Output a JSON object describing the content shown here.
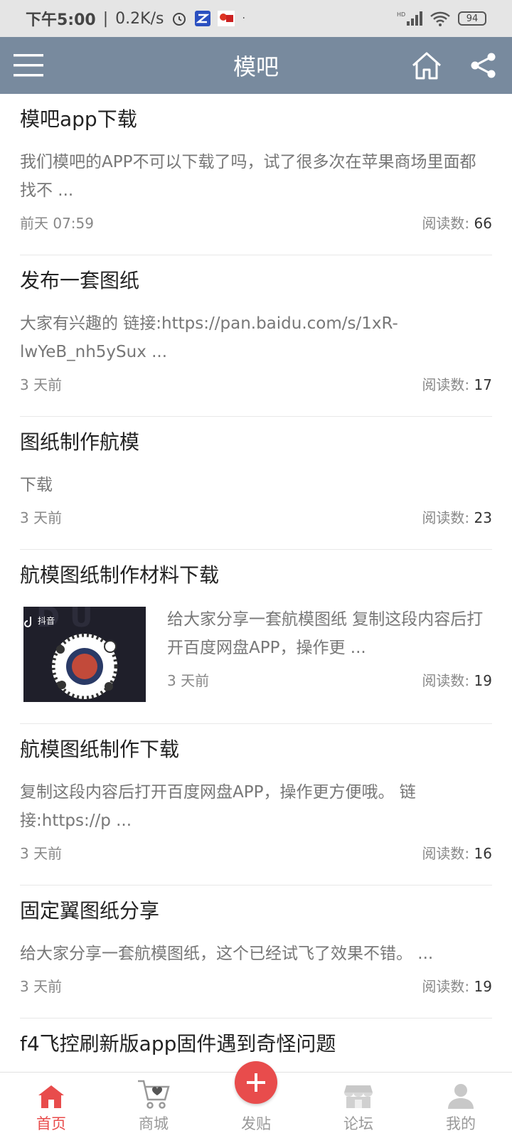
{
  "status_bar": {
    "time": "下午5:00",
    "speed": "0.2K/s",
    "network": "HD",
    "battery": "94"
  },
  "header": {
    "title": "模吧",
    "bg_color": "#788a9e"
  },
  "posts": [
    {
      "title": "模吧app下载",
      "excerpt": "我们模吧的APP不可以下载了吗，试了很多次在苹果商场里面都找不 ...",
      "time": "前天 07:59",
      "reads_label": "阅读数:",
      "reads": "66"
    },
    {
      "title": "发布一套图纸",
      "excerpt": "大家有兴趣的 链接:https://pan.baidu.com/s/1xR-lwYeB_nh5ySux ...",
      "time": "3 天前",
      "reads_label": "阅读数:",
      "reads": "17"
    },
    {
      "title": "图纸制作航模",
      "excerpt": "下载",
      "time": "3 天前",
      "reads_label": "阅读数:",
      "reads": "23"
    },
    {
      "title": "航模图纸制作材料下载",
      "excerpt": "给大家分享一套航模图纸 复制这段内容后打开百度网盘APP，操作更 ...",
      "time": "3 天前",
      "reads_label": "阅读数:",
      "reads": "19",
      "thumb_label": "抖音"
    },
    {
      "title": "航模图纸制作下载",
      "excerpt": "复制这段内容后打开百度网盘APP，操作更方便哦。 链接:https://p ...",
      "time": "3 天前",
      "reads_label": "阅读数:",
      "reads": "16"
    },
    {
      "title": "固定翼图纸分享",
      "excerpt": "给大家分享一套航模图纸，这个已经试飞了效果不错。 ...",
      "time": "3 天前",
      "reads_label": "阅读数:",
      "reads": "19"
    },
    {
      "title": "f4飞控刷新版app固件遇到奇怪问题"
    }
  ],
  "bottom_nav": {
    "items": [
      {
        "label": "首页",
        "icon": "home-icon",
        "active": true
      },
      {
        "label": "商城",
        "icon": "cart-icon"
      },
      {
        "label": "发贴",
        "icon": "plus-icon"
      },
      {
        "label": "论坛",
        "icon": "forum-icon"
      },
      {
        "label": "我的",
        "icon": "user-icon"
      }
    ],
    "active_color": "#e84c4c"
  }
}
